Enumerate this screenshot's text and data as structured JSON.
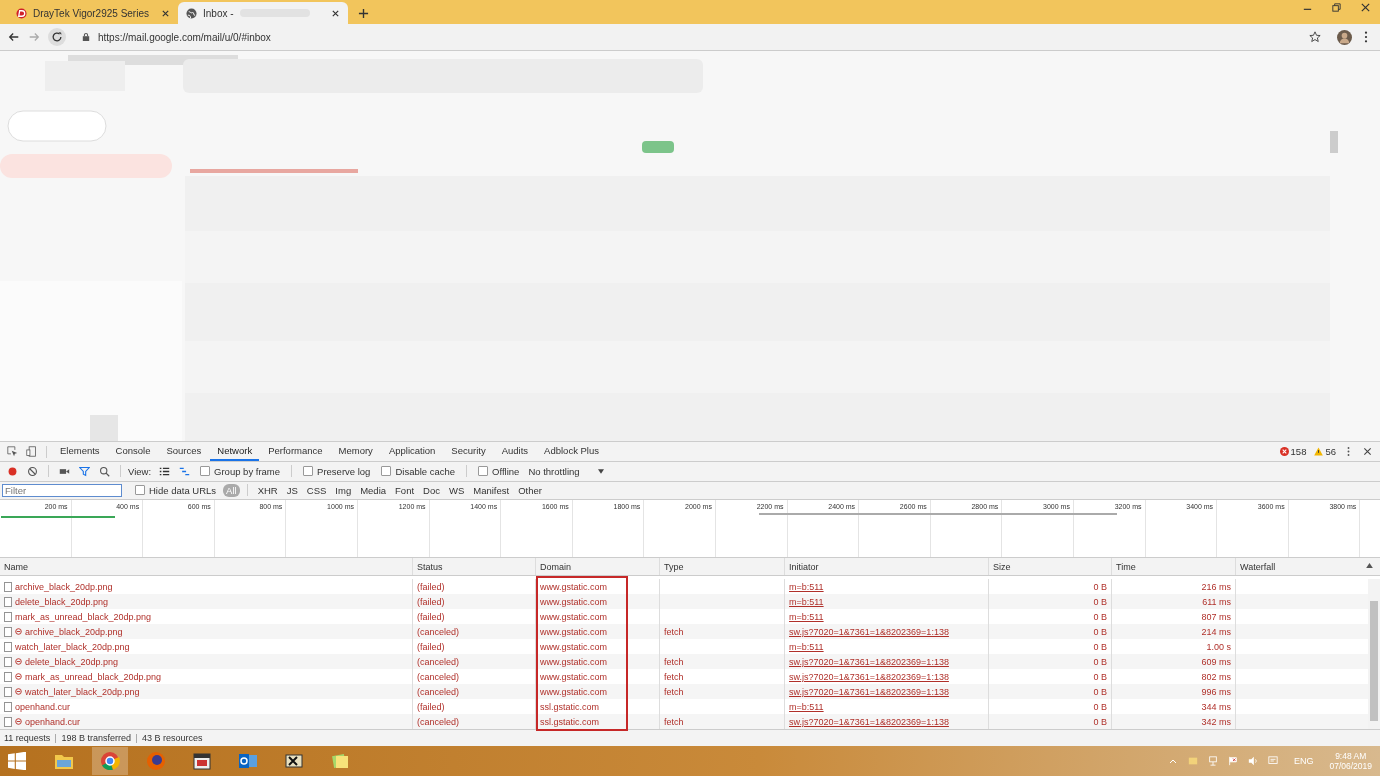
{
  "browser": {
    "tabs": [
      {
        "title": "DrayTek Vigor2925 Series",
        "selected": false
      },
      {
        "title": "Inbox -",
        "selected": true
      }
    ],
    "address": "https://mail.google.com/mail/u/0/#inbox"
  },
  "devtools": {
    "tabs": [
      {
        "label": "Elements",
        "selected": false
      },
      {
        "label": "Console",
        "selected": false
      },
      {
        "label": "Sources",
        "selected": false
      },
      {
        "label": "Network",
        "selected": true
      },
      {
        "label": "Performance",
        "selected": false
      },
      {
        "label": "Memory",
        "selected": false
      },
      {
        "label": "Application",
        "selected": false
      },
      {
        "label": "Security",
        "selected": false
      },
      {
        "label": "Audits",
        "selected": false
      },
      {
        "label": "Adblock Plus",
        "selected": false
      }
    ],
    "errors": "158",
    "warnings": "56",
    "toolbar": {
      "recording": true,
      "filter_on": true,
      "view_label": "View:",
      "checkboxes": [
        {
          "label": "Group by frame",
          "checked": false
        },
        {
          "label": "Preserve log",
          "checked": false
        },
        {
          "label": "Disable cache",
          "checked": false
        },
        {
          "label": "Offline",
          "checked": false
        }
      ],
      "throttling": "No throttling"
    },
    "filter": {
      "placeholder": "Filter",
      "hide_data_urls": {
        "label": "Hide data URLs",
        "checked": false
      },
      "types": [
        {
          "label": "All",
          "selected": true
        },
        {
          "label": "XHR",
          "selected": false
        },
        {
          "label": "JS",
          "selected": false
        },
        {
          "label": "CSS",
          "selected": false
        },
        {
          "label": "Img",
          "selected": false
        },
        {
          "label": "Media",
          "selected": false
        },
        {
          "label": "Font",
          "selected": false
        },
        {
          "label": "Doc",
          "selected": false
        },
        {
          "label": "WS",
          "selected": false
        },
        {
          "label": "Manifest",
          "selected": false
        },
        {
          "label": "Other",
          "selected": false
        }
      ]
    },
    "timeline_ticks": [
      "200 ms",
      "400 ms",
      "600 ms",
      "800 ms",
      "1000 ms",
      "1200 ms",
      "1400 ms",
      "1600 ms",
      "1800 ms",
      "2000 ms",
      "2200 ms",
      "2400 ms",
      "2600 ms",
      "2800 ms",
      "3000 ms",
      "3200 ms",
      "3400 ms",
      "3600 ms",
      "3800 ms"
    ],
    "table": {
      "columns": [
        "Name",
        "Status",
        "Domain",
        "Type",
        "Initiator",
        "Size",
        "Time",
        "Waterfall"
      ],
      "rows": [
        {
          "name": "archive_black_20dp.png",
          "blocked": false,
          "status": "(failed)",
          "domain": "www.gstatic.com",
          "initiator": "m=b:511",
          "size": "0 B",
          "time": "216 ms"
        },
        {
          "name": "delete_black_20dp.png",
          "blocked": false,
          "status": "(failed)",
          "domain": "www.gstatic.com",
          "initiator": "m=b:511",
          "size": "0 B",
          "time": "611 ms"
        },
        {
          "name": "mark_as_unread_black_20dp.png",
          "blocked": false,
          "status": "(failed)",
          "domain": "www.gstatic.com",
          "initiator": "m=b:511",
          "size": "0 B",
          "time": "807 ms"
        },
        {
          "name": "archive_black_20dp.png",
          "blocked": true,
          "status": "(canceled)",
          "domain": "www.gstatic.com",
          "type": "fetch",
          "initiator": "sw.js?7020=1&7361=1&8202369=1:138",
          "size": "0 B",
          "time": "214 ms"
        },
        {
          "name": "watch_later_black_20dp.png",
          "blocked": false,
          "status": "(failed)",
          "domain": "www.gstatic.com",
          "initiator": "m=b:511",
          "size": "0 B",
          "time": "1.00 s"
        },
        {
          "name": "delete_black_20dp.png",
          "blocked": true,
          "status": "(canceled)",
          "domain": "www.gstatic.com",
          "type": "fetch",
          "initiator": "sw.js?7020=1&7361=1&8202369=1:138",
          "size": "0 B",
          "time": "609 ms"
        },
        {
          "name": "mark_as_unread_black_20dp.png",
          "blocked": true,
          "status": "(canceled)",
          "domain": "www.gstatic.com",
          "type": "fetch",
          "initiator": "sw.js?7020=1&7361=1&8202369=1:138",
          "size": "0 B",
          "time": "802 ms"
        },
        {
          "name": "watch_later_black_20dp.png",
          "blocked": true,
          "status": "(canceled)",
          "domain": "www.gstatic.com",
          "type": "fetch",
          "initiator": "sw.js?7020=1&7361=1&8202369=1:138",
          "size": "0 B",
          "time": "996 ms"
        },
        {
          "name": "openhand.cur",
          "blocked": false,
          "status": "(failed)",
          "domain": "ssl.gstatic.com",
          "initiator": "m=b:511",
          "size": "0 B",
          "time": "344 ms"
        },
        {
          "name": "openhand.cur",
          "blocked": true,
          "status": "(canceled)",
          "domain": "ssl.gstatic.com",
          "type": "fetch",
          "initiator": "sw.js?7020=1&7361=1&8202369=1:138",
          "size": "0 B",
          "time": "342 ms"
        }
      ]
    },
    "summary": [
      "11 requests",
      "198 B transferred",
      "43 B resources"
    ]
  },
  "taskbar": {
    "language": "ENG",
    "time": "9:48 AM",
    "date": "07/06/2019"
  }
}
